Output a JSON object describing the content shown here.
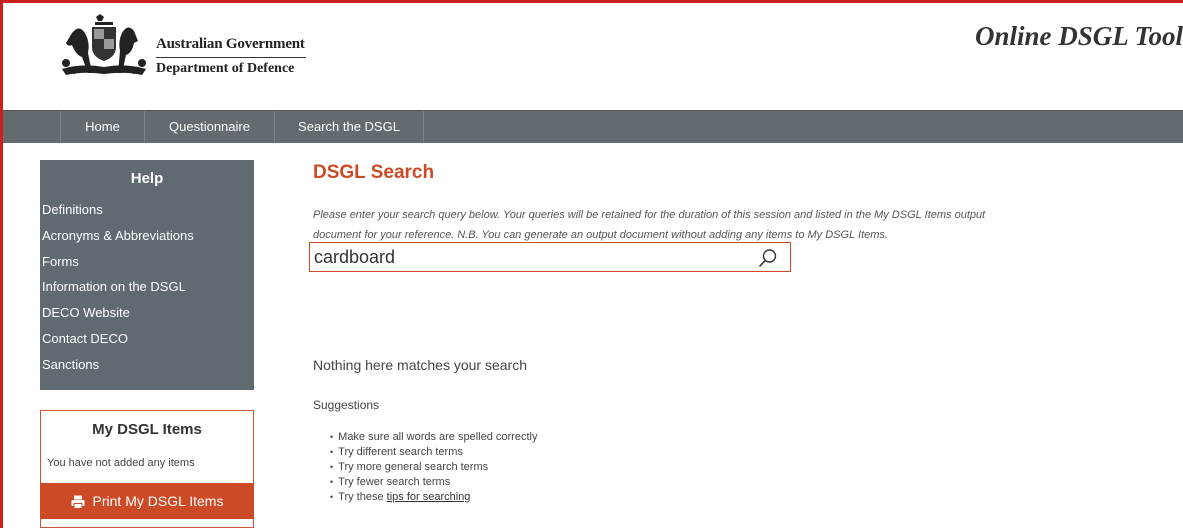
{
  "header": {
    "gov_name": "Australian Government",
    "dept_name": "Department of Defence",
    "app_title": "Online DSGL Tool",
    "crest_icon": "coat-of-arms-icon"
  },
  "nav": {
    "items": [
      {
        "label": "Home"
      },
      {
        "label": "Questionnaire"
      },
      {
        "label": "Search the DSGL"
      }
    ]
  },
  "sidebar": {
    "help_title": "Help",
    "help_items": [
      "Definitions",
      "Acronyms & Abbreviations",
      "Forms",
      "Information on the DSGL",
      "DECO Website",
      "Contact DECO",
      "Sanctions"
    ],
    "my_items_title": "My DSGL Items",
    "my_items_note": "You have not added any items",
    "print_label": "Print My DSGL Items",
    "print_icon": "printer-icon"
  },
  "main": {
    "title": "DSGL Search",
    "intro_line1": "Please enter your search query below. Your queries will be retained for the duration of this session and listed in the My DSGL Items output",
    "intro_line2": "document for your reference. N.B. You can generate an output document without adding any items to My DSGL Items.",
    "search_value": "cardboard",
    "search_icon": "search-icon",
    "no_results": "Nothing here matches your search",
    "suggestions_title": "Suggestions",
    "suggestions": [
      "Make sure all words are spelled correctly",
      "Try different search terms",
      "Try more general search terms",
      "Try fewer search terms"
    ],
    "last_suggestion_prefix": "Try these ",
    "tips_link": "tips for searching"
  },
  "colors": {
    "accent": "#cc4a26",
    "nav_bg": "#636b70",
    "help_bg": "#5f6a71",
    "frame": "#cc1f1f"
  }
}
